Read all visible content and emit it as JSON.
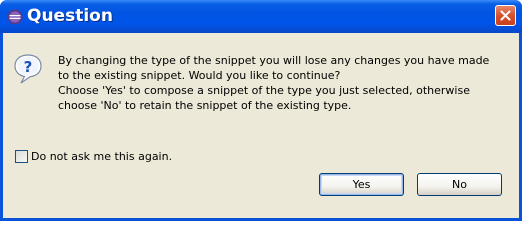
{
  "window": {
    "title": "Question",
    "title_icon": "eclipse-app-icon",
    "close_icon": "close-icon"
  },
  "dialog": {
    "icon": "question-icon",
    "message_lines": [
      "By changing the type of the snippet you will lose any changes you have made",
      "to the existing snippet.  Would you like to continue?",
      "Choose 'Yes' to compose a snippet of the type you just selected, otherwise",
      "choose 'No' to retain the snippet of the existing type."
    ],
    "checkbox": {
      "label": "Do not ask me this again.",
      "checked": false
    },
    "buttons": {
      "yes": "Yes",
      "no": "No"
    }
  },
  "colors": {
    "titlebar": "#0055ea",
    "client_bg": "#ece9d8",
    "close_button": "#d8512e"
  }
}
